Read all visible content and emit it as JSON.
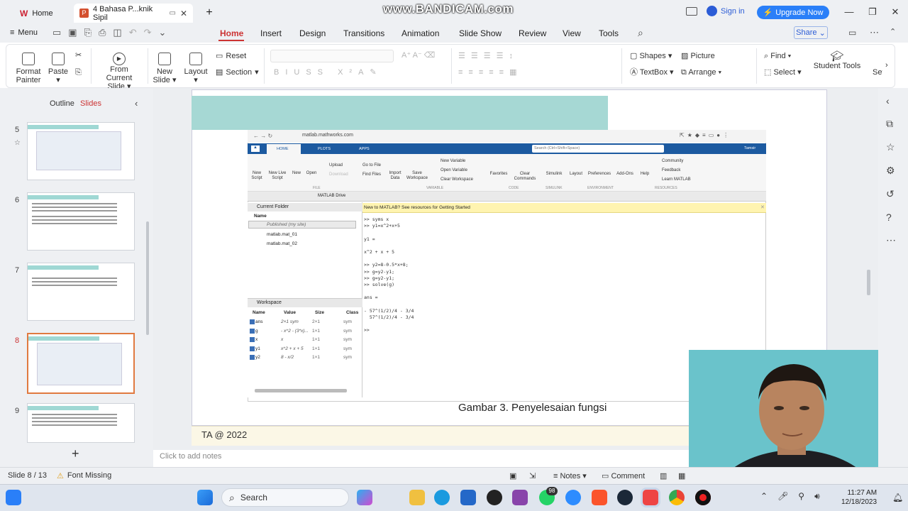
{
  "browser": {
    "tabs": [
      {
        "label": "Home"
      },
      {
        "label": "4 Bahasa P...knik Sipil"
      }
    ],
    "watermark": "www.BANDICAM.com",
    "sign_in": "Sign in",
    "upgrade": "Upgrade Now"
  },
  "menu": {
    "menu_label": "Menu",
    "items": [
      "Home",
      "Insert",
      "Design",
      "Transitions",
      "Animation",
      "Slide Show",
      "Review",
      "View",
      "Tools"
    ],
    "active": "Home",
    "share": "Share"
  },
  "ribbon": {
    "format_painter": "Format Painter",
    "paste": "Paste",
    "from_current_slide": "From Current Slide",
    "new_slide": "New Slide",
    "layout": "Layout",
    "reset": "Reset",
    "section": "Section",
    "shapes": "Shapes",
    "picture": "Picture",
    "textbox": "TextBox",
    "arrange": "Arrange",
    "find": "Find",
    "select": "Select",
    "student_tools": "Student Tools",
    "set": "Set"
  },
  "left_pane": {
    "tabs": [
      "Outline",
      "Slides"
    ],
    "active_tab": "Slides",
    "slides": [
      {
        "num": "5"
      },
      {
        "num": "6"
      },
      {
        "num": "7"
      },
      {
        "num": "8"
      },
      {
        "num": "9"
      }
    ],
    "active_slide": "8"
  },
  "slide": {
    "caption": "Gambar 3. Penyelesaian fungsi",
    "footer": "TA @ 2022",
    "notes_placeholder": "Click to add notes"
  },
  "matlab": {
    "url": "matlab.mathworks.com",
    "tabs": [
      "HOME",
      "PLOTS",
      "APPS"
    ],
    "search_placeholder": "Search (Ctrl+Shift+Space)",
    "user": "Tamsir",
    "toolbar": {
      "new_script": "New Script",
      "new_live_script": "New Live Script",
      "new": "New",
      "open": "Open",
      "upload": "Upload",
      "download": "Download",
      "go_to_file": "Go to File",
      "find_files": "Find Files",
      "import_data": "Import Data",
      "save_workspace": "Save Workspace",
      "new_variable": "New Variable",
      "open_variable": "Open Variable",
      "clear_workspace": "Clear Workspace",
      "favorites": "Favorites",
      "clear_commands": "Clear Commands",
      "simulink": "Simulink",
      "layout": "Layout",
      "preferences": "Preferences",
      "add_ons": "Add-Ons",
      "help": "Help",
      "community": "Community",
      "feedback": "Feedback",
      "learn_matlab": "Learn MATLAB"
    },
    "groups": [
      "FILE",
      "VARIABLE",
      "CODE",
      "SIMULINK",
      "ENVIRONMENT",
      "RESOURCES"
    ],
    "path": "MATLAB Drive",
    "current_folder": {
      "title": "Current Folder",
      "column": "Name",
      "items": [
        "Published (my site)",
        "matlab.mat_01",
        "matlab.mat_02"
      ]
    },
    "workspace": {
      "title": "Workspace",
      "columns": [
        "Name",
        "Value",
        "Size",
        "Class"
      ],
      "rows": [
        {
          "name": "ans",
          "value": "2×1 sym",
          "size": "2×1",
          "class": "sym"
        },
        {
          "name": "g",
          "value": "- x^2 - (3*x)...",
          "size": "1×1",
          "class": "sym"
        },
        {
          "name": "x",
          "value": "x",
          "size": "1×1",
          "class": "sym"
        },
        {
          "name": "y1",
          "value": "x^2 + x + 5",
          "size": "1×1",
          "class": "sym"
        },
        {
          "name": "y2",
          "value": "8 - x/2",
          "size": "1×1",
          "class": "sym"
        }
      ]
    },
    "banner": "New to MATLAB? See resources for Getting Started",
    "command_lines": [
      ">> syms x",
      ">> y1=x^2+x+5",
      "",
      "y1 =",
      "",
      "x^2 + x + 5",
      "",
      ">> y2=8-0.5*x+8;",
      ">> g=y2-y1;",
      ">> g=y2-y1;",
      ">> solve(g)",
      "",
      "ans =",
      "",
      "- 57^(1/2)/4 - 3/4",
      "  57^(1/2)/4 - 3/4",
      "",
      ">>"
    ]
  },
  "status": {
    "slide_info": "Slide 8 / 13",
    "font_missing": "Font Missing",
    "notes": "Notes",
    "comment": "Comment"
  },
  "taskbar": {
    "search": "Search",
    "time": "11:27 AM",
    "date": "12/18/2023",
    "badge": "98"
  },
  "colors": {
    "accent_red": "#cc3333",
    "teal_band": "#a6d8d4",
    "matlab_blue": "#1c5aa0",
    "upgrade_blue": "#2a7ff8"
  }
}
